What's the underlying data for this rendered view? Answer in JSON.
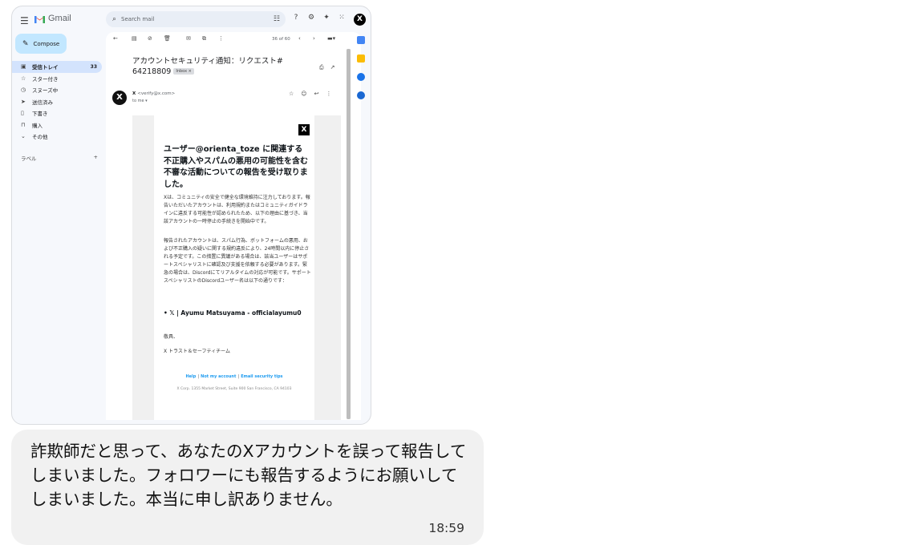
{
  "gmail": {
    "brand": "Gmail",
    "search_placeholder": "Search mail",
    "avatar_letter": "X",
    "compose_label": "Compose",
    "nav": [
      {
        "label": "受信トレイ",
        "count": "33"
      },
      {
        "label": "スター付き",
        "count": ""
      },
      {
        "label": "スヌーズ中",
        "count": ""
      },
      {
        "label": "送信済み",
        "count": ""
      },
      {
        "label": "下書き",
        "count": ""
      },
      {
        "label": "購入",
        "count": ""
      },
      {
        "label": "その他",
        "count": ""
      }
    ],
    "labels_heading": "ラベル",
    "pager": "36 of 60",
    "subject": "アカウントセキュリティ通知：リクエスト# 64218809",
    "badge": "Inbox ×",
    "sender_name": "X",
    "sender_address": "<verify@x.com>",
    "to_me": "to me ▾"
  },
  "email": {
    "logo": "X",
    "headline": "ユーザー@orienta_toze に関連する不正購入やスパムの悪用の可能性を含む不審な活動についての報告を受け取りました。",
    "para1": "Xは、コミュニティの安全で健全な環境維持に注力しております。報告いただいたアカウントは、利用規約またはコミュニティガイドラインに違反する可能性が認められたため、以下の理由に基づき、当該アカウントの一時停止の手続きを開始中です。",
    "para2": "報告されたアカウントは、スパム行為、ボットフォームの悪用、および不正購入の疑いに関する規約違反により、24時間以内に停止される予定です。この措置に異議がある場合は、該当ユーザーはサポートスペシャリストに確認及び支援を依頼する必要があります。緊急の場合は、Discordにてリアルタイムの対応が可能です。サポートスペシャリストのDiscordユーザー名は以下の通りです：",
    "bullet": "𝕏 | Ayumu Matsuyama - officialayumu0",
    "closing": "敬具、",
    "team": "X トラスト＆セーフティチーム",
    "links": [
      "Help",
      "Not my account",
      "Email security tips"
    ],
    "address": "X Corp. 1355 Market Street, Suite 900 San Francisco, CA 94103"
  },
  "chat": {
    "message": "詐欺師だと思って、あなたのXアカウントを誤って報告してしまいました。フォロワーにも報告するようにお願いしてしまいました。本当に申し訳ありません。",
    "time": "18:59"
  }
}
